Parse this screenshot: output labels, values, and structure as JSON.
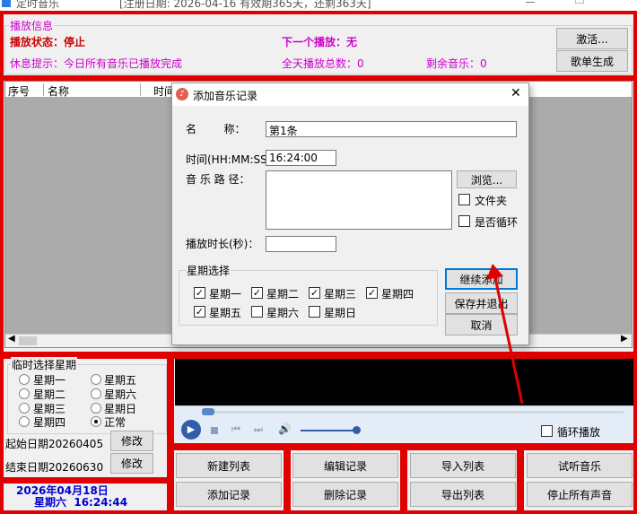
{
  "titlebar": {
    "app_title": "定时音乐",
    "reg_info": "[注册日期: 2026-04-16   有效期365天，还剩363天]"
  },
  "info": {
    "group_title": "播放信息",
    "status_label": "播放状态：停止",
    "next_label": "下一个播放：无",
    "rest_hint": "休息提示：今日所有音乐已播放完成",
    "total_today": "全天播放总数：0",
    "remaining": "剩余音乐：0",
    "activate_btn": "激活...",
    "gen_playlist_btn": "歌单生成"
  },
  "table": {
    "columns": [
      "序号",
      "名称",
      "时间"
    ]
  },
  "temp_week": {
    "title": "临时选择星期",
    "options": [
      "星期一",
      "星期五",
      "星期二",
      "星期六",
      "星期三",
      "星期日",
      "星期四",
      "正常"
    ],
    "selected": "正常",
    "start_label": "起始日期20260405",
    "end_label": "结束日期20260630",
    "modify_btn": "修改"
  },
  "clock": {
    "date": "2026年04月18日",
    "weekday_time": "星期六  16:24:44"
  },
  "player": {
    "loop_label": "循环播放"
  },
  "buttons": {
    "new_list": "新建列表",
    "add_record": "添加记录",
    "edit_record": "编辑记录",
    "delete_record": "删除记录",
    "import_list": "导入列表",
    "export_list": "导出列表",
    "preview_music": "试听音乐",
    "stop_all": "停止所有声音"
  },
  "dialog": {
    "title": "添加音乐记录",
    "name_label": "名        称：",
    "name_value": "第1条",
    "time_label": "时间(HH:MM:SS)：",
    "time_value": "16:24:00",
    "path_label": "音 乐 路 径：",
    "browse_btn": "浏览...",
    "folder_label": "文件夹",
    "loop_label": "是否循环",
    "duration_label": "播放时长(秒)：",
    "week_group": "星期选择",
    "days": [
      "星期一",
      "星期二",
      "星期三",
      "星期四",
      "星期五",
      "星期六",
      "星期日"
    ],
    "days_checked": [
      true,
      true,
      true,
      true,
      true,
      false,
      false
    ],
    "continue_btn": "继续添加",
    "save_exit_btn": "保存并退出",
    "cancel_btn": "取消",
    "close_glyph": "✕"
  },
  "colors": {
    "highlight_red": "#e00000",
    "status_red": "#cc0000",
    "next_magenta": "#cc00cc",
    "clock_blue": "#0000cc"
  }
}
